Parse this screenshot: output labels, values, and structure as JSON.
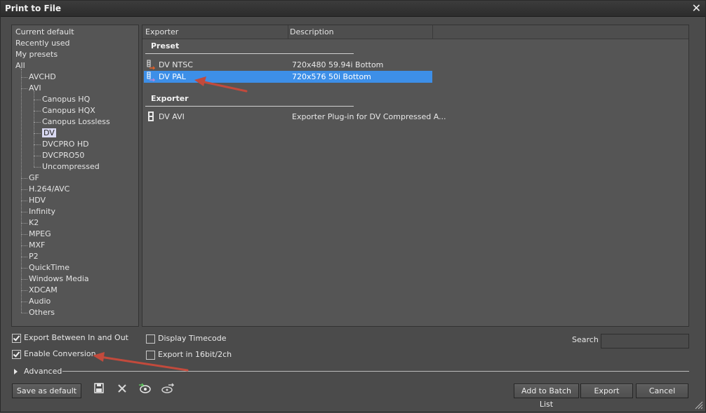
{
  "window": {
    "title": "Print to File"
  },
  "tree": {
    "root_items": [
      "Current default",
      "Recently used",
      "My presets",
      "All"
    ],
    "all_children": [
      {
        "label": "AVCHD"
      },
      {
        "label": "AVI",
        "children": [
          "Canopus HQ",
          "Canopus HQX",
          "Canopus Lossless",
          "DV",
          "DVCPRO HD",
          "DVCPRO50",
          "Uncompressed"
        ]
      },
      {
        "label": "GF"
      },
      {
        "label": "H.264/AVC"
      },
      {
        "label": "HDV"
      },
      {
        "label": "Infinity"
      },
      {
        "label": "K2"
      },
      {
        "label": "MPEG"
      },
      {
        "label": "MXF"
      },
      {
        "label": "P2"
      },
      {
        "label": "QuickTime"
      },
      {
        "label": "Windows Media"
      },
      {
        "label": "XDCAM"
      },
      {
        "label": "Audio"
      },
      {
        "label": "Others"
      }
    ],
    "selected": "DV"
  },
  "list": {
    "columns": [
      "Exporter",
      "Description"
    ],
    "groups": [
      {
        "title": "Preset",
        "rows": [
          {
            "name": "DV NTSC",
            "desc": "720x480 59.94i Bottom",
            "selected": false
          },
          {
            "name": "DV PAL",
            "desc": "720x576 50i Bottom",
            "selected": true
          }
        ]
      },
      {
        "title": "Exporter",
        "rows": [
          {
            "name": "DV AVI",
            "desc": "Exporter Plug-in for DV Compressed A...",
            "selected": false
          }
        ]
      }
    ]
  },
  "options": {
    "export_between": {
      "label": "Export Between In and Out",
      "checked": true
    },
    "enable_conversion": {
      "label": "Enable Conversion",
      "checked": true
    },
    "display_timecode": {
      "label": "Display Timecode",
      "checked": false
    },
    "export_16bit": {
      "label": "Export in 16bit/2ch",
      "checked": false
    }
  },
  "search": {
    "label": "Search",
    "value": ""
  },
  "advanced": {
    "label": "Advanced"
  },
  "buttons": {
    "save_default": "Save as default",
    "add_batch": "Add to Batch List",
    "export": "Export",
    "cancel": "Cancel"
  },
  "colors": {
    "selection": "#3d8fe8",
    "annotation_arrow": "#c0392b"
  }
}
